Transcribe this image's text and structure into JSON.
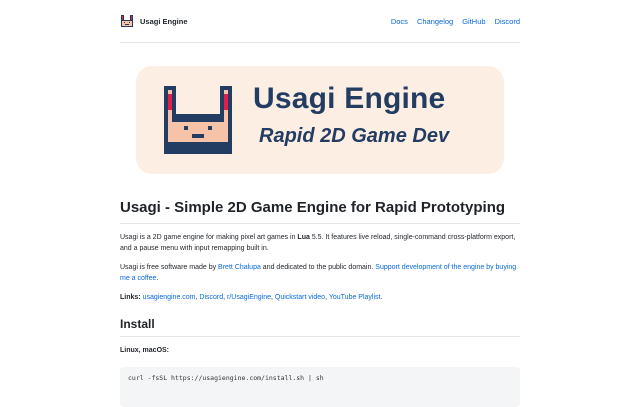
{
  "header": {
    "brand": "Usagi Engine",
    "nav": [
      "Docs",
      "Changelog",
      "GitHub",
      "Discord"
    ]
  },
  "hero": {
    "title": "Usagi Engine",
    "subtitle": "Rapid 2D Game Dev"
  },
  "article": {
    "title": "Usagi - Simple 2D Game Engine for Rapid Prototyping",
    "intro_prefix": "Usagi is a 2D game engine for making pixel art games in ",
    "intro_lua": "Lua",
    "intro_suffix": " 5.5. It features live reload, single-command cross-platform export, and a pause menu with input remapping built in.",
    "free_prefix": "Usagi is free software made by ",
    "author": "Brett Chalupa",
    "free_middle": " and dedicated to the public domain. ",
    "support": "Support development of the engine by buying me a coffee",
    "free_suffix": ".",
    "links_label": "Links:",
    "links": [
      "usagiengine.com",
      "Discord",
      "r/UsagiEngine",
      "Quickstart video",
      "YouTube Playlist"
    ],
    "links_end": ".",
    "install_heading": "Install",
    "platform": "Linux, macOS:",
    "code": "curl -fsSL https://usagiengine.com/install.sh | sh"
  },
  "colors": {
    "link": "#0969da",
    "hero_bg": "#fdeee4",
    "hero_text": "#233c62"
  }
}
